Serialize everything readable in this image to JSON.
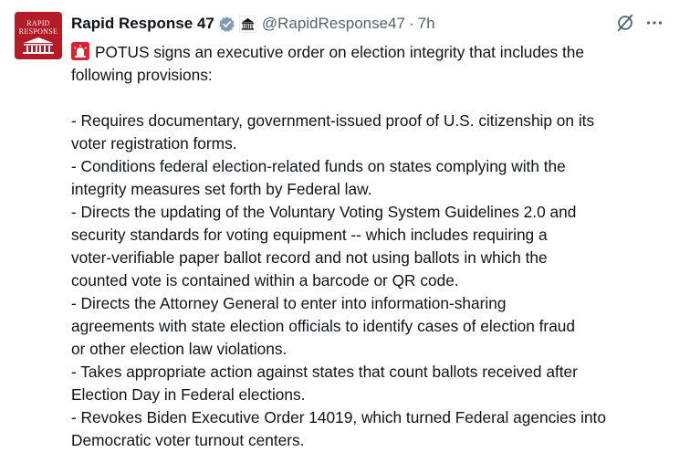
{
  "author": {
    "display_name": "Rapid Response 47",
    "handle": "@RapidResponse47",
    "separator": "·",
    "time": "7h",
    "avatar_text": [
      "RAPID",
      "RESPONSE"
    ]
  },
  "icons": {
    "verified": "verified-badge-icon",
    "affiliation": "white-house-affiliation-icon",
    "grok": "grok-icon",
    "more": "more-options-icon",
    "siren": "siren-emoji-icon"
  },
  "colors": {
    "verified_badge": "#829aab",
    "avatar_bg": "#b51a27",
    "secondary_text": "#536471",
    "siren": "#e0202f"
  },
  "tweet": {
    "lines": [
      "POTUS signs an executive order on election integrity that includes the",
      "following provisions:",
      "",
      "- Requires documentary, government-issued proof of U.S. citizenship on its",
      "voter registration forms.",
      "- Conditions federal election-related funds on states complying with the",
      "integrity measures set forth by Federal law.",
      "- Directs the updating of the Voluntary Voting System Guidelines 2.0 and",
      "security standards for voting equipment -- which includes requiring a",
      "voter-verifiable paper ballot record and not using ballots in which the",
      "counted vote is contained within a barcode or QR code.",
      "- Directs the Attorney General to enter into information-sharing",
      "agreements with state election officials to identify cases of election fraud",
      "or other election law violations.",
      "- Takes appropriate action against states that count ballots received after",
      "Election Day in Federal elections.",
      "- Revokes Biden Executive Order 14019, which turned Federal agencies into",
      "Democratic voter turnout centers."
    ]
  }
}
